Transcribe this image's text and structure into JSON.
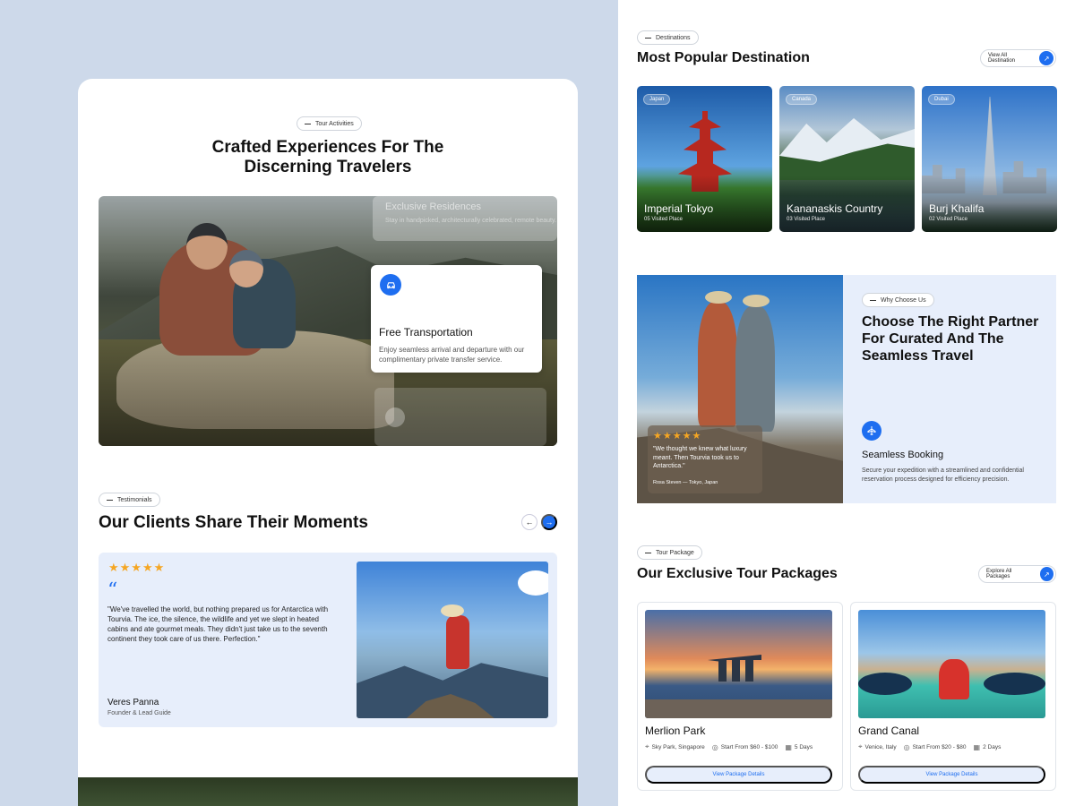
{
  "tour_activities": {
    "pill": "Tour Activities",
    "title_line1": "Crafted Experiences For The",
    "title_line2": "Discerning Travelers",
    "ghost_card_title": "Exclusive Residences",
    "ghost_card_text": "Stay in handpicked, architecturally celebrated, remote beauty.",
    "feature": {
      "icon": "car-icon",
      "title": "Free Transportation",
      "desc": "Enjoy seamless arrival and departure with our complimentary private transfer service."
    }
  },
  "testimonials": {
    "pill": "Testimonials",
    "title": "Our Clients Share Their Moments",
    "prev": "←",
    "next": "→",
    "stars": "★★★★★",
    "rating": 5,
    "quote_mark": "“",
    "quote": "\"We've travelled the world, but nothing prepared us for Antarctica with Tourvia. The ice, the silence, the wildlife and yet we slept in heated cabins and ate gourmet meals. They didn't just take us to the seventh continent they took care of us there. Perfection.\"",
    "name": "Veres Panna",
    "role": "Founder & Lead Guide"
  },
  "destinations": {
    "pill": "Destinations",
    "title": "Most Popular Destination",
    "view_all": "View All Destination",
    "items": [
      {
        "tag": "Japan",
        "name": "Imperial Tokyo",
        "sub": "05 Visited Place"
      },
      {
        "tag": "Canada",
        "name": "Kananaskis Country",
        "sub": "03 Visited Place"
      },
      {
        "tag": "Dubai",
        "name": "Burj Khalifa",
        "sub": "02 Visited Place"
      }
    ]
  },
  "why": {
    "pill": "Why Choose Us",
    "title": "Choose The Right Partner For Curated And The Seamless Travel",
    "review_stars": "★★★★★",
    "review_quote": "\"We thought we knew what luxury meant. Then Tourvia took us to Antarctica.\"",
    "review_author": "Rosa Steven  —  Tokyo, Japan",
    "feature_icon": "airplane-icon",
    "feature_title": "Seamless Booking",
    "feature_desc": "Secure your expedition with a streamlined and confidential reservation process designed for efficiency precision."
  },
  "packages": {
    "pill": "Tour Package",
    "title": "Our Exclusive Tour Packages",
    "explore": "Explore All Packages",
    "items": [
      {
        "name": "Merlion Park",
        "location": "Sky Park, Singapore",
        "price": "Start From $60 - $100",
        "days": "5 Days",
        "button": "View Package Details"
      },
      {
        "name": "Grand Canal",
        "location": "Venice, Italy",
        "price": "Start From $20 - $80",
        "days": "2 Days",
        "button": "View Package Details"
      }
    ]
  },
  "colors": {
    "accent": "#1e6ef0",
    "panel": "#e7eefb",
    "star": "#f5a623",
    "page_bg": "#cdd9ea"
  }
}
